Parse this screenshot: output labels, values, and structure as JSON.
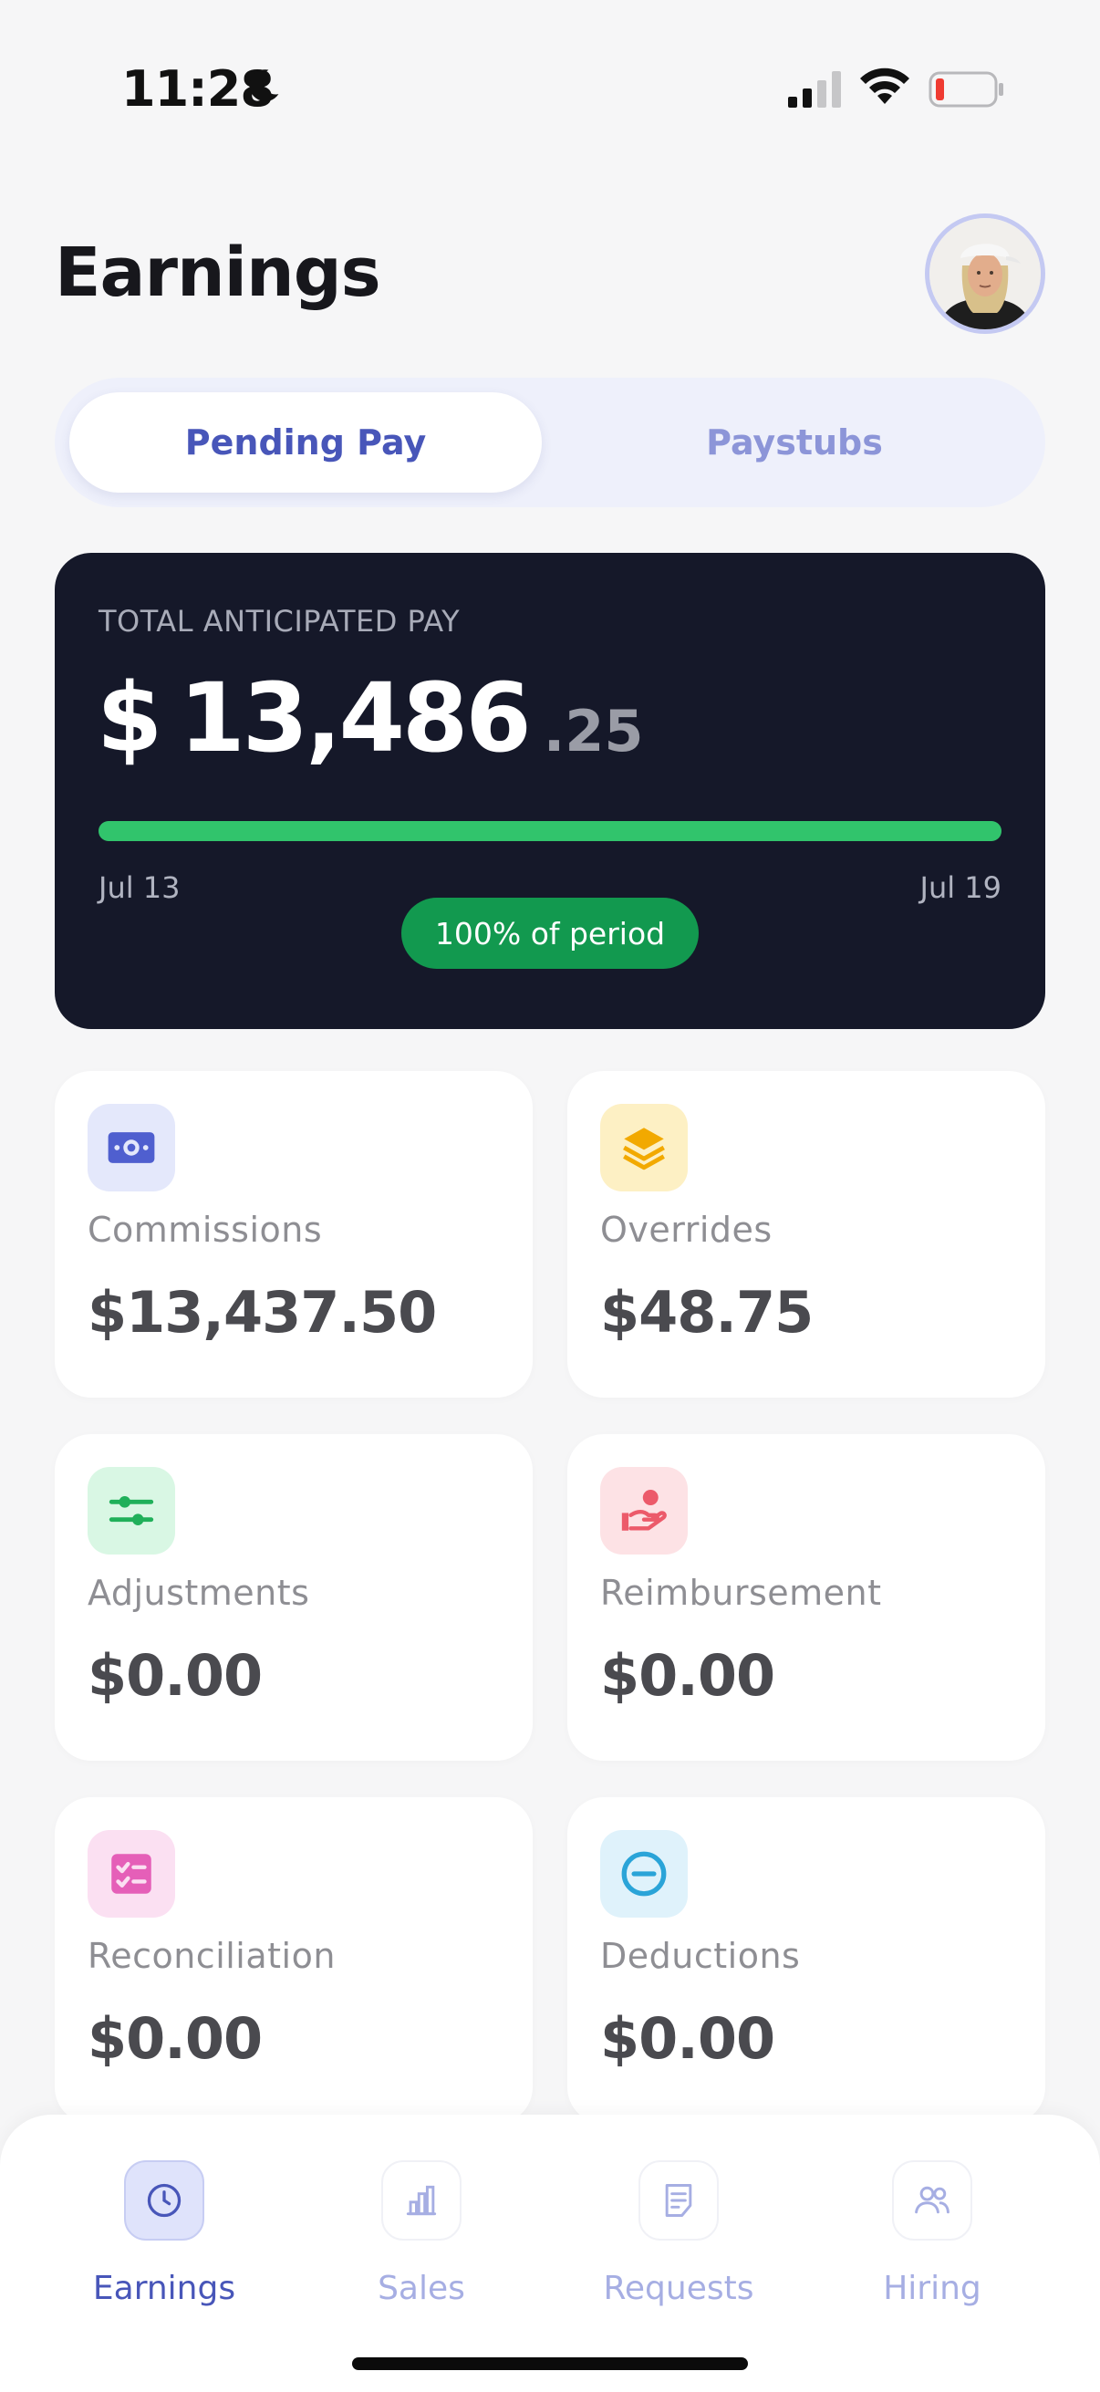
{
  "status_bar": {
    "time": "11:28",
    "icons": [
      "moon-icon",
      "signal-icon",
      "wifi-icon",
      "battery-icon"
    ]
  },
  "header": {
    "title": "Earnings",
    "avatar_icon": "avatar"
  },
  "tabs": {
    "pending_pay": "Pending Pay",
    "paystubs": "Paystubs",
    "selected": "Pending Pay"
  },
  "total": {
    "label": "TOTAL ANTICIPATED PAY",
    "currency": "$",
    "whole": "13,486",
    "cents": ".25",
    "progress": 1.0,
    "start": "Jul 13",
    "end": "Jul 19",
    "badge": "100% of period"
  },
  "categories": [
    {
      "label": "Commissions",
      "value": "$13,437.50",
      "icon": "cash-icon",
      "icon_color": "#4f5fcf",
      "icon_bg": "#e4e8fb"
    },
    {
      "label": "Overrides",
      "value": "$48.75",
      "icon": "layers-icon",
      "icon_color": "#f2a900",
      "icon_bg": "#fdf0c4"
    },
    {
      "label": "Adjustments",
      "value": "$0.00",
      "icon": "sliders-icon",
      "icon_color": "#20b05a",
      "icon_bg": "#d9f7e4"
    },
    {
      "label": "Reimbursement",
      "value": "$0.00",
      "icon": "hand-coin-icon",
      "icon_color": "#ec5a6a",
      "icon_bg": "#fde2e5"
    },
    {
      "label": "Reconciliation",
      "value": "$0.00",
      "icon": "checklist-icon",
      "icon_color": "#e55fb8",
      "icon_bg": "#fbe0f2"
    },
    {
      "label": "Deductions",
      "value": "$0.00",
      "icon": "minus-circle-icon",
      "icon_color": "#2aa4d8",
      "icon_bg": "#dff2fb"
    }
  ],
  "nav": {
    "items": [
      {
        "label": "Earnings",
        "icon": "clock-icon"
      },
      {
        "label": "Sales",
        "icon": "bar-chart-icon"
      },
      {
        "label": "Requests",
        "icon": "document-icon"
      },
      {
        "label": "Hiring",
        "icon": "people-icon"
      }
    ],
    "active": "Earnings"
  }
}
